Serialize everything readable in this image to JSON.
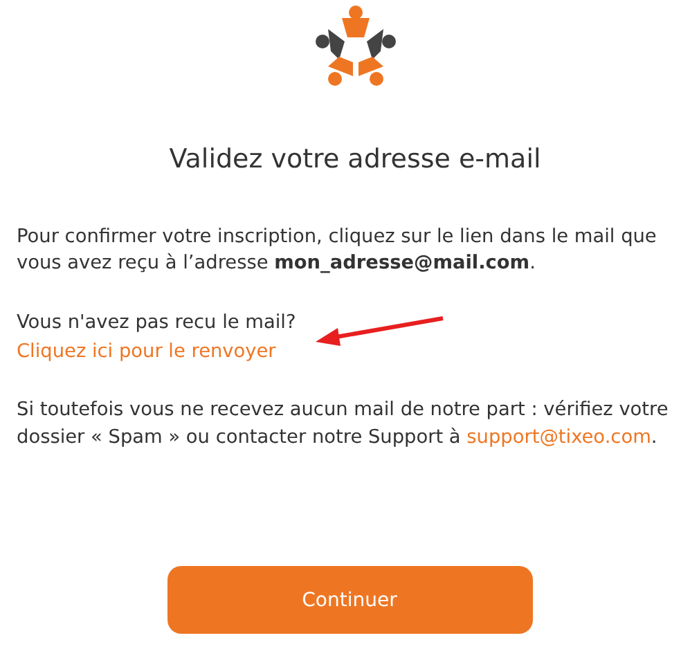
{
  "title": "Validez votre adresse e-mail",
  "confirmation_text": "Pour confirmer votre inscription, cliquez sur le lien dans le mail que vous avez reçu à l’adresse **mon_adresse@mail.com**.",
  "resend": {
    "question": "Vous n'avez pas recu le mail?",
    "link": "Cliquez ici pour le renvoyer"
  },
  "support": {
    "text": "Si toutefois vous ne recevez aucun mail de notre part : vérifiez votre dossier « Spam » ou contacter notre Support à ",
    "link": "support@tixeo.com",
    "end": "."
  },
  "button": "Continuer"
}
